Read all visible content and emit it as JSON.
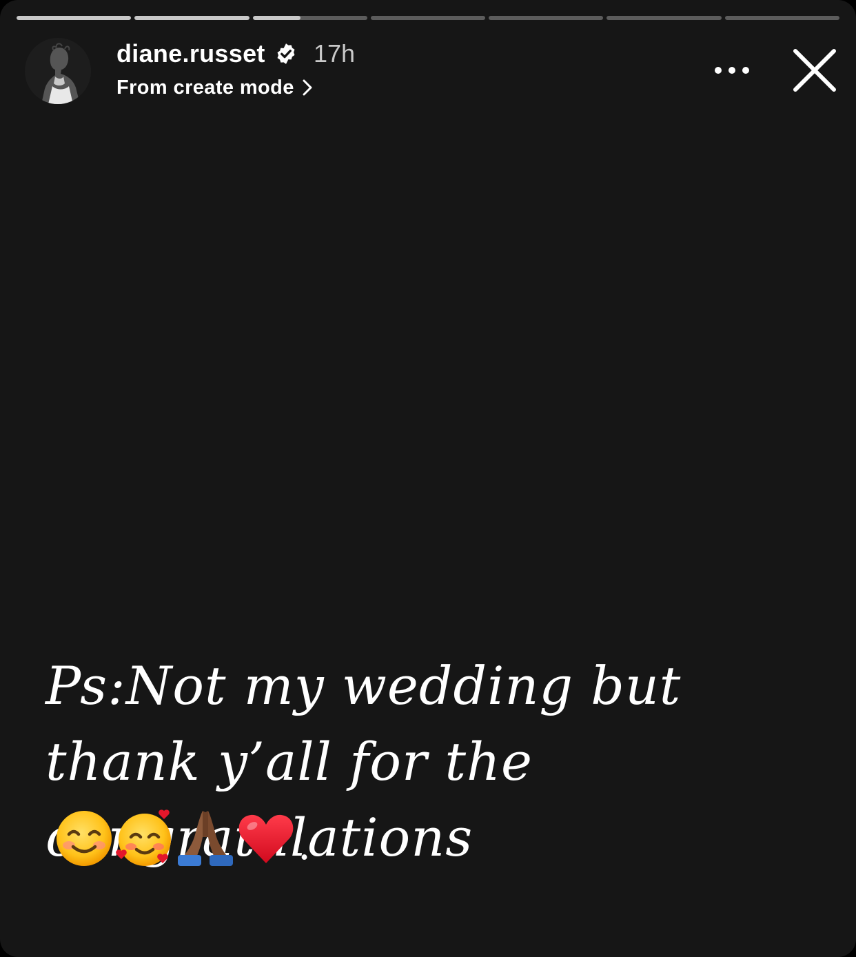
{
  "story": {
    "progress": [
      1,
      1,
      0.42,
      0,
      0,
      0,
      0
    ]
  },
  "header": {
    "username": "diane.russet",
    "verified": true,
    "time_ago": "17h",
    "subline": "From create mode",
    "more_icon": "more-horizontal-icon",
    "close_icon": "close-icon"
  },
  "caption": {
    "text": "Ps:Not my wedding but thank y’all for the congratulations",
    "emojis": [
      "smiling-face-icon",
      "smiling-face-with-hearts-icon",
      "folded-hands-icon",
      "red-heart-icon"
    ],
    "trailing": "."
  },
  "colors": {
    "background": "#161616",
    "progress_active": "#c8c8c8",
    "text": "#ffffff",
    "muted_text": "#c9c9c9"
  }
}
